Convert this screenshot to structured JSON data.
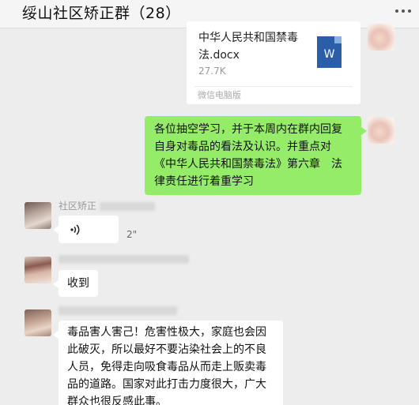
{
  "header": {
    "title": "绥山社区矫正群（28）",
    "more_icon": "more-icon"
  },
  "messages": {
    "file": {
      "name": "中华人民共和国禁毒法.docx",
      "size": "27.7K",
      "source": "微信电脑版",
      "icon_letter": "W"
    },
    "notice": {
      "text": "各位抽空学习，并于本周内在群内回复自身对毒品的看法及认识。并重点对《中华人民共和国禁毒法》第六章　法律责任进行着重学习"
    },
    "voice": {
      "sender": "社区矫正",
      "duration": "2\""
    },
    "reply": {
      "text": "收到"
    },
    "long_reply": {
      "text": "毒品害人害己！危害性极大，家庭也会因此破灭，所以最好不要沾染社会上的不良人员，免得走向吸食毒品从而走上贩卖毒品的道路。国家对此打击力度很大，广大群众也很反感此事。"
    }
  },
  "colors": {
    "my_bubble": "#95ec69",
    "other_bubble": "#ffffff",
    "background": "#ededed"
  }
}
